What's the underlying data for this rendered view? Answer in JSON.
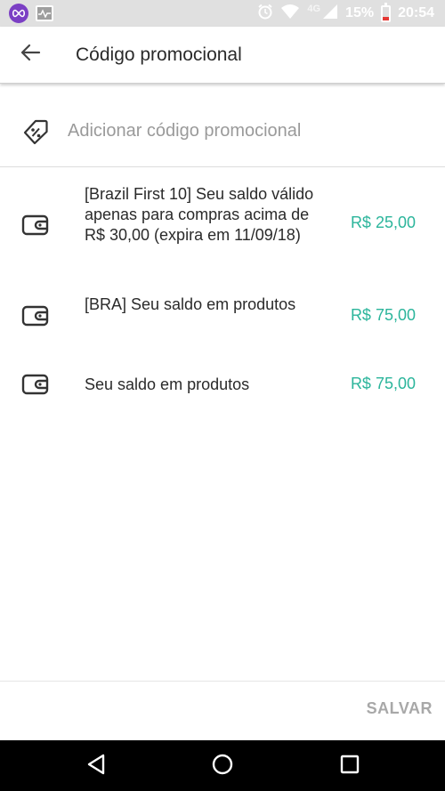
{
  "status_bar": {
    "network": "4G",
    "battery": "15%",
    "time": "20:54",
    "icons": [
      "infinity-app-icon",
      "activity-monitor-icon",
      "alarm-icon",
      "wifi-icon",
      "signal-icon",
      "battery-icon"
    ]
  },
  "app_bar": {
    "back_icon": "arrow-left-icon",
    "title": "Código promocional"
  },
  "promo": {
    "icon": "discount-tag-icon",
    "placeholder": "Adicionar código promocional",
    "value": ""
  },
  "credits": [
    {
      "icon": "wallet-icon",
      "description": "[Brazil First 10] Seu saldo válido apenas para compras acima de R$ 30,00 (expira em 11/09/18)",
      "amount": "R$ 25,00"
    },
    {
      "icon": "wallet-icon",
      "description": "[BRA] Seu saldo em produtos",
      "amount": "R$ 75,00"
    },
    {
      "icon": "wallet-icon",
      "description": "Seu saldo em produtos",
      "amount": "R$ 75,00"
    }
  ],
  "actions": {
    "save_label": "SALVAR"
  },
  "colors": {
    "accent_green": "#2bb59b",
    "disabled_text": "#a8a8a8",
    "status_bar_bg": "#e0e0e0"
  },
  "nav_bar": {
    "icons": [
      "back-triangle-icon",
      "home-circle-icon",
      "recents-square-icon"
    ]
  }
}
